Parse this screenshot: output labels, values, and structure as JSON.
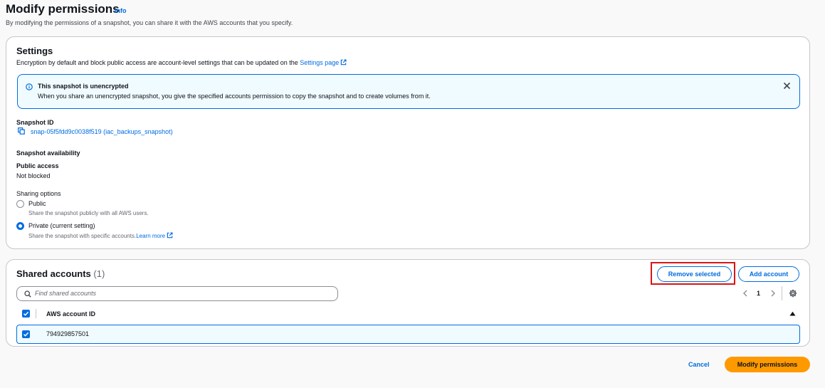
{
  "header": {
    "title": "Modify permissions",
    "info": "Info",
    "description": "By modifying the permissions of a snapshot, you can share it with the AWS accounts that you specify."
  },
  "settings": {
    "title": "Settings",
    "description": "Encryption by default and block public access are account-level settings that can be updated on the",
    "settings_link": "Settings page",
    "alert": {
      "title": "This snapshot is unencrypted",
      "body": "When you share an unencrypted snapshot, you give the specified accounts permission to copy the snapshot and to create volumes from it."
    },
    "snapshot_id_label": "Snapshot ID",
    "snapshot_id_value": "snap-05f5fdd9c0038f519 (iac_backups_snapshot)",
    "availability_label": "Snapshot availability",
    "public_access_label": "Public access",
    "public_access_value": "Not blocked",
    "sharing_label": "Sharing options",
    "options": [
      {
        "label": "Public",
        "description": "Share the snapshot publicly with all AWS users.",
        "checked": false
      },
      {
        "label": "Private (current setting)",
        "description": "Share the snapshot with specific accounts.",
        "learn_more": "Learn more",
        "checked": true
      }
    ]
  },
  "shared_accounts": {
    "title": "Shared accounts",
    "count": "(1)",
    "remove_button": "Remove selected",
    "add_button": "Add account",
    "search_placeholder": "Find shared accounts",
    "page": "1",
    "column_header": "AWS account ID",
    "rows": [
      {
        "account_id": "794929857501",
        "selected": true
      }
    ]
  },
  "footer": {
    "cancel": "Cancel",
    "submit": "Modify permissions"
  },
  "colors": {
    "accent": "#006ce0",
    "primary_button": "#ff9900",
    "highlight_border": "#d91515"
  }
}
